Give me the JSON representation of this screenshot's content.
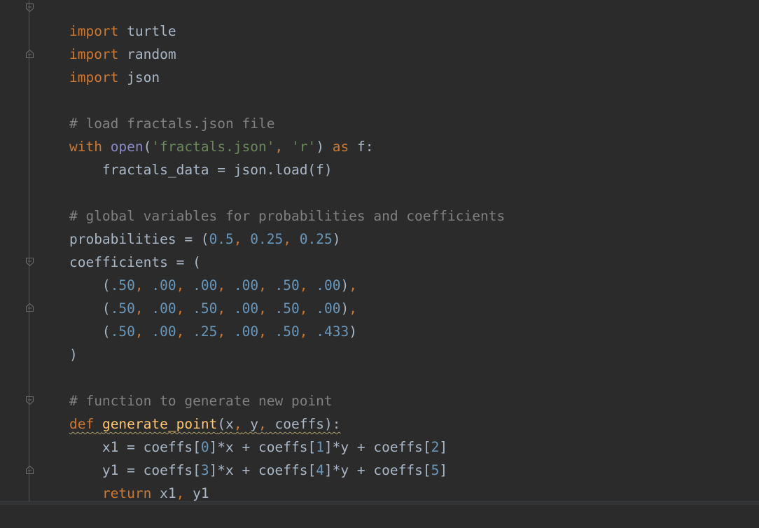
{
  "editor": {
    "language": "python",
    "colors": {
      "background": "#2b2b2b",
      "keyword": "#cc7832",
      "identifier": "#a9b7c6",
      "comment": "#808080",
      "string": "#6a8759",
      "number": "#6897bb",
      "builtin": "#8888c6",
      "function_name": "#ffc66d"
    }
  },
  "code": {
    "l1": {
      "kw": "import",
      "name": " turtle"
    },
    "l2": {
      "kw": "import",
      "name": " random"
    },
    "l3": {
      "kw": "import",
      "name": " json"
    },
    "l5": {
      "comment": "# load fractals.json file"
    },
    "l6": {
      "kw_with": "with",
      "sp1": " ",
      "builtin": "open",
      "lp": "(",
      "str1": "'fractals.json'",
      "comma": ",",
      "sp2": " ",
      "str2": "'r'",
      "rp": ")",
      "sp3": " ",
      "kw_as": "as",
      "tail": " f:"
    },
    "l7": {
      "text": "    fractals_data = json.load(f)"
    },
    "l9": {
      "comment": "# global variables for probabilities and coefficients"
    },
    "l10": {
      "head": "probabilities = (",
      "n1": "0.5",
      "c1": ",",
      "n2": " 0.25",
      "c2": ",",
      "n3": " 0.25",
      "tail": ")"
    },
    "l11": {
      "text": "coefficients = ("
    },
    "l12": {
      "indent": "    (",
      "n1": ".50",
      "c1": ",",
      "n2": " .00",
      "c2": ",",
      "n3": " .00",
      "c3": ",",
      "n4": " .00",
      "c4": ",",
      "n5": " .50",
      "c5": ",",
      "n6": " .00",
      "close": ")",
      "c6": ","
    },
    "l13": {
      "indent": "    (",
      "n1": ".50",
      "c1": ",",
      "n2": " .00",
      "c2": ",",
      "n3": " .50",
      "c3": ",",
      "n4": " .00",
      "c4": ",",
      "n5": " .50",
      "c5": ",",
      "n6": " .00",
      "close": ")",
      "c6": ","
    },
    "l14": {
      "indent": "    (",
      "n1": ".50",
      "c1": ",",
      "n2": " .00",
      "c2": ",",
      "n3": " .25",
      "c3": ",",
      "n4": " .00",
      "c4": ",",
      "n5": " .50",
      "c5": ",",
      "n6": " .433",
      "close": ")"
    },
    "l15": {
      "text": ")"
    },
    "l17": {
      "comment": "# function to generate new point"
    },
    "l18": {
      "kw": "def",
      "sp": " ",
      "fn": "generate_point",
      "lp": "(x",
      "c1": ",",
      "a2": " y",
      "c2": ",",
      "a3": " coeffs):"
    },
    "l19": {
      "head": "    x1 = coeffs[",
      "n1": "0",
      "m1": "]*x + coeffs[",
      "n2": "1",
      "m2": "]*y + coeffs[",
      "n3": "2",
      "tail": "]"
    },
    "l20": {
      "head": "    y1 = coeffs[",
      "n1": "3",
      "m1": "]*x + coeffs[",
      "n2": "4",
      "m2": "]*y + coeffs[",
      "n3": "5",
      "tail": "]"
    },
    "l21": {
      "indent": "    ",
      "kw": "return",
      "a": " x1",
      "c": ",",
      "b": " y1"
    }
  }
}
